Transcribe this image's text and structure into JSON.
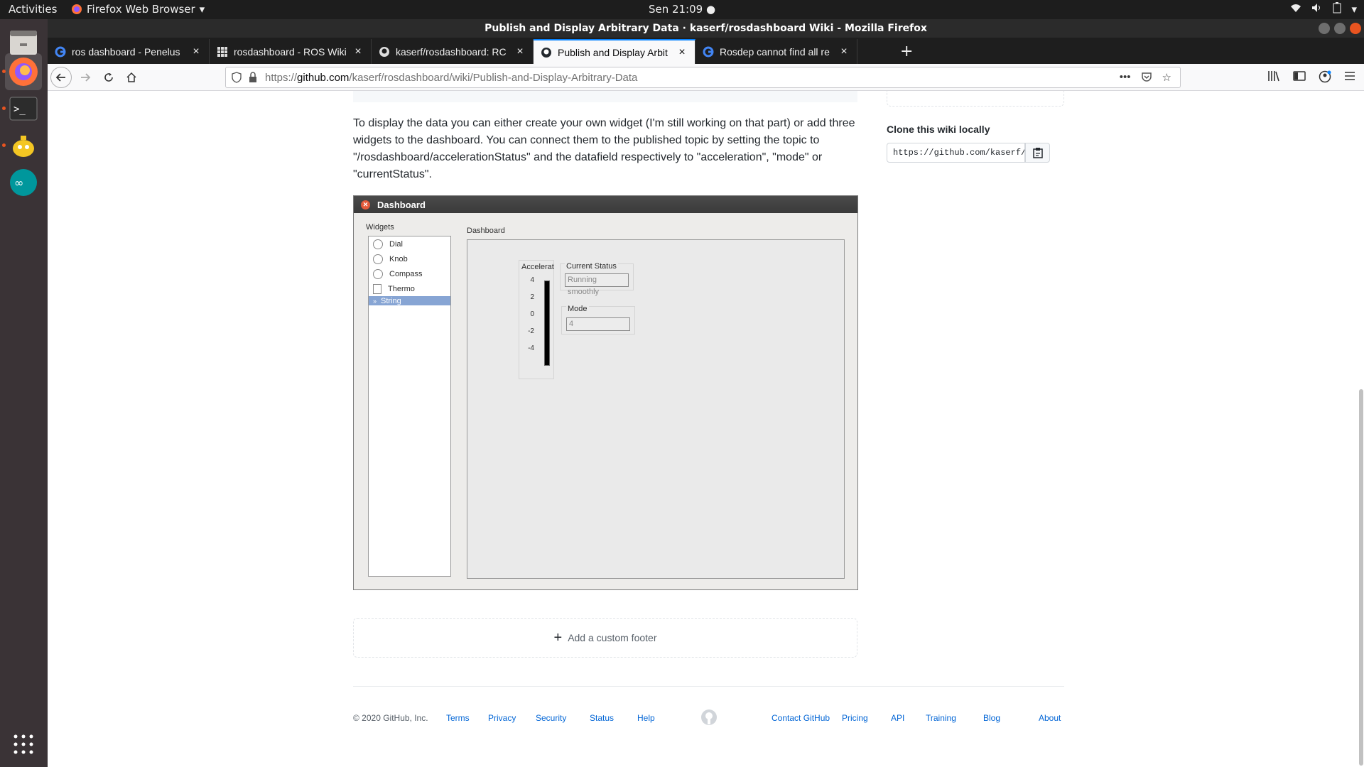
{
  "topbar": {
    "activities": "Activities",
    "app_name": "Firefox Web Browser",
    "clock": "Sen 21:09"
  },
  "window": {
    "title": "Publish and Display Arbitrary Data · kaserf/rosdashboard Wiki - Mozilla Firefox"
  },
  "tabs": [
    {
      "label": "ros dashboard - Penelus",
      "icon": "google-icon",
      "active": false
    },
    {
      "label": "rosdashboard - ROS Wiki",
      "icon": "ros-wiki-icon",
      "active": false
    },
    {
      "label": "kaserf/rosdashboard: RC",
      "icon": "github-icon",
      "active": false
    },
    {
      "label": "Publish and Display Arbit",
      "icon": "github-icon",
      "active": true
    },
    {
      "label": "Rosdep cannot find all re",
      "icon": "google-icon",
      "active": false
    }
  ],
  "url": {
    "prefix": "https://",
    "host": "github.com",
    "path": "/kaserf/rosdashboard/wiki/Publish-and-Display-Arbitrary-Data"
  },
  "content": {
    "paragraph": "To display the data you can either create your own widget (I'm still working on that part) or add three widgets to the dashboard. You can connect them to the published topic by setting the topic to \"/rosdashboard/accelerationStatus\" and the datafield respectively to \"acceleration\", \"mode\" or \"currentStatus\".",
    "footer_add": "Add a custom footer"
  },
  "dashboard": {
    "title": "Dashboard",
    "widgets_label": "Widgets",
    "widgets": [
      "Dial",
      "Knob",
      "Compass",
      "Thermo",
      "String"
    ],
    "selected_widget": "String",
    "panel_label": "Dashboard",
    "accel_label": "Acceleration",
    "accel_ticks": [
      "4",
      "2",
      "0",
      "-2",
      "-4"
    ],
    "status_label": "Current Status",
    "status_value": "Running smoothly",
    "mode_label": "Mode",
    "mode_value": "4"
  },
  "sidebar": {
    "clone_title": "Clone this wiki locally",
    "clone_url": "https://github.com/kaserf/rosdashboard.wiki.git"
  },
  "footer": {
    "copyright": "© 2020 GitHub, Inc.",
    "left_links": [
      "Terms",
      "Privacy",
      "Security",
      "Status",
      "Help"
    ],
    "right_links": [
      "Contact GitHub",
      "Pricing",
      "API",
      "Training",
      "Blog",
      "About"
    ]
  },
  "colors": {
    "link": "#0366d6",
    "ubuntu_accent": "#e95420",
    "tab_active_indicator": "#0a84ff"
  }
}
